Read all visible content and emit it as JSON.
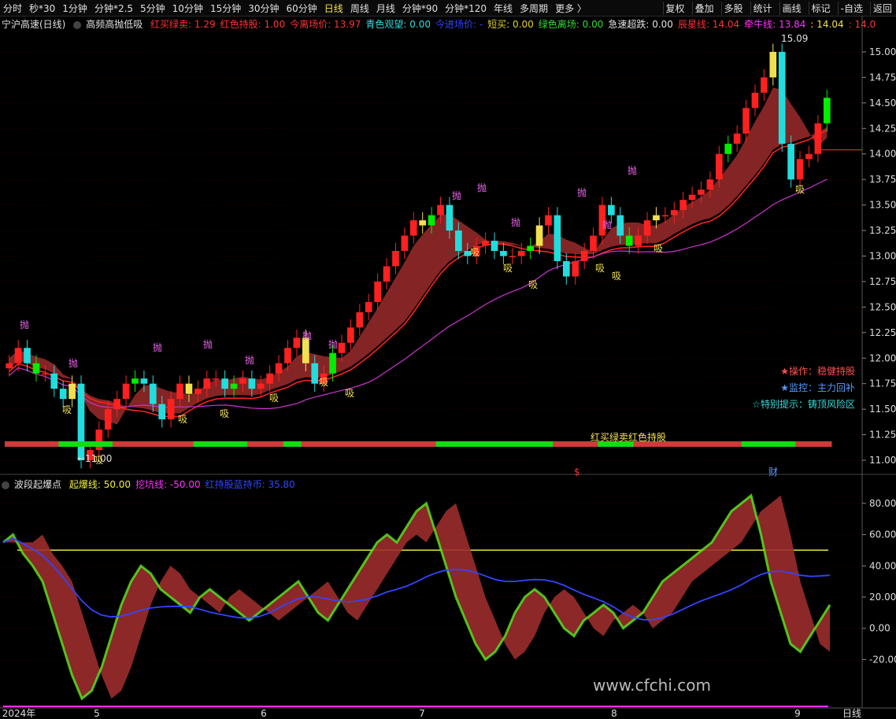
{
  "toolbar": {
    "periods": [
      "分时",
      "秒*30",
      "1分钟",
      "分钟*2.5",
      "5分钟",
      "10分钟",
      "15分钟",
      "30分钟",
      "60分钟",
      "日线",
      "周线",
      "月线",
      "分钟*90",
      "分钟*120",
      "年线",
      "多周期",
      "更多 〉"
    ],
    "active_period": "日线",
    "right_buttons": [
      "复权",
      "叠加",
      "多股",
      "统计",
      "画线",
      "标记",
      "-自选",
      "返回"
    ]
  },
  "main_legend": {
    "stock": "宁沪高速(日线)",
    "indicator": "高频高抛低吸",
    "items": [
      {
        "label": "红买绿卖: 1.29",
        "color": "#ff3333"
      },
      {
        "label": "红色持股: 1.00",
        "color": "#ff3333"
      },
      {
        "label": "今离场价: 13.97",
        "color": "#ff3333"
      },
      {
        "label": "青色观望: 0.00",
        "color": "#33dddd"
      },
      {
        "label": "今进场价: -",
        "color": "#3344ff"
      },
      {
        "label": "短买: 0.00",
        "color": "#e0d030"
      },
      {
        "label": "绿色离场: 0.00",
        "color": "#33dd33"
      },
      {
        "label": "急速超跌: 0.00",
        "color": "#e0e0e0"
      },
      {
        "label": "辰星线: 14.04",
        "color": "#ff3333"
      },
      {
        "label": "牵牛线: 13.84",
        "color": "#ff33ff"
      },
      {
        "label": ": 14.04",
        "color": "#f0e050"
      },
      {
        "label": ": 14.0",
        "color": "#ff3333"
      }
    ]
  },
  "sub_legend": {
    "indicator": "波段起爆点",
    "items": [
      {
        "label": "起爆线: 50.00",
        "color": "#f0f040"
      },
      {
        "label": "挖坑线: -50.00",
        "color": "#ff33ff"
      },
      {
        "label": "红持股蓝持币: 35.80",
        "color": "#3344ff"
      }
    ]
  },
  "notes": [
    {
      "label": "★操作：稳健持股",
      "color": "#ff5050"
    },
    {
      "label": "★监控：主力回补",
      "color": "#5599ff"
    },
    {
      "label": "☆特别提示：铸顶风险区",
      "color": "#33dddd"
    }
  ],
  "band_label": "红买绿卖红色持股",
  "markers": {
    "dollar": "$",
    "cai": "财"
  },
  "watermark": "www.cfchi.com",
  "colors": {
    "up": "#ff2020",
    "down": "#22dddd",
    "buy": "#00ee00",
    "yellow": "#f0e050",
    "band": "#b03030"
  },
  "chart_data": [
    {
      "type": "candlestick",
      "title": "宁沪高速(日线)",
      "ylim": [
        10.9,
        15.2
      ],
      "y_ticks": [
        "15.00",
        "14.75",
        "14.50",
        "14.25",
        "14.00",
        "13.75",
        "13.50",
        "13.25",
        "13.00",
        "12.75",
        "12.50",
        "12.25",
        "12.00",
        "11.75",
        "11.50",
        "11.25",
        "11.00"
      ],
      "close": [
        11.95,
        12.1,
        11.95,
        11.85,
        11.85,
        11.7,
        11.6,
        11.75,
        11.0,
        11.1,
        11.3,
        11.5,
        11.6,
        11.75,
        11.8,
        11.75,
        11.55,
        11.4,
        11.6,
        11.75,
        11.65,
        11.7,
        11.8,
        11.8,
        11.7,
        11.75,
        11.8,
        11.7,
        11.75,
        11.85,
        11.95,
        12.1,
        12.2,
        11.95,
        11.75,
        11.85,
        12.05,
        12.15,
        12.3,
        12.45,
        12.55,
        12.75,
        12.9,
        13.05,
        13.2,
        13.35,
        13.3,
        13.4,
        13.5,
        13.25,
        13.05,
        13.0,
        13.1,
        13.15,
        13.05,
        13.0,
        13.0,
        13.05,
        13.1,
        13.3,
        13.4,
        12.95,
        12.8,
        12.95,
        13.05,
        13.2,
        13.5,
        13.4,
        13.2,
        13.1,
        13.2,
        13.35,
        13.4,
        13.4,
        13.45,
        13.55,
        13.6,
        13.65,
        13.75,
        14.0,
        14.1,
        14.2,
        14.45,
        14.6,
        14.75,
        15.0,
        14.1,
        13.75,
        13.95,
        14.0,
        14.3,
        14.55
      ],
      "annotations": {
        "high": "15.09",
        "low": "11.00",
        "last": "14.04"
      },
      "signals": [
        "抛",
        "吸"
      ]
    },
    {
      "type": "line",
      "title": "波段起爆点",
      "ylim": [
        -50,
        90
      ],
      "y_ticks": [
        "80.00",
        "60.00",
        "40.00",
        "20.00",
        "0.00",
        "-20.00"
      ],
      "series": [
        {
          "name": "起爆线",
          "values": [
            50
          ]
        },
        {
          "name": "挖坑线",
          "values": [
            -50
          ]
        },
        {
          "name": "红持股蓝持币",
          "values": [
            35.8
          ]
        }
      ]
    }
  ],
  "x_labels": [
    "2024年",
    "5",
    "6",
    "7",
    "8",
    "9"
  ],
  "x_axis_title": "日线"
}
